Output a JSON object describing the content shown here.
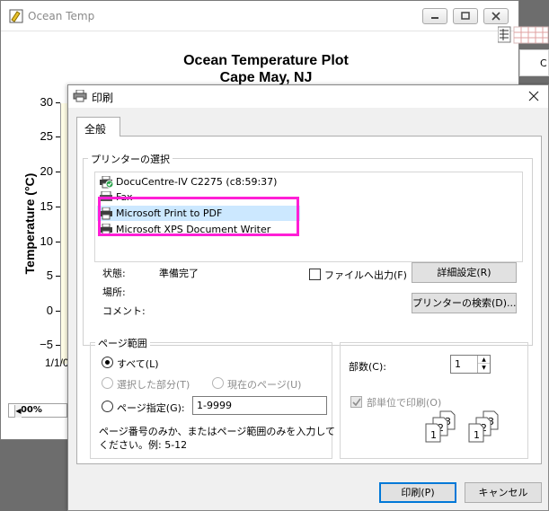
{
  "app": {
    "title": "Ocean Temp",
    "plot_title_line1": "Ocean Temperature Plot",
    "plot_title_line2": "Cape May, NJ",
    "ylabel": "Temperature (°C)",
    "yticks": [
      "30",
      "25",
      "20",
      "15",
      "10",
      "5",
      "0",
      "−5"
    ],
    "xtick_partial": "1/1/0",
    "zoom": "100%",
    "right_strip_char": "C"
  },
  "dialog": {
    "title": "印刷",
    "tab_general": "全般",
    "printer_group_label": "プリンターの選択",
    "printers": [
      {
        "name": "DocuCentre-IV C2275 (c8:59:37)",
        "icon": "default-printer-icon"
      },
      {
        "name": "Fax",
        "icon": "fax-icon"
      },
      {
        "name": "Microsoft Print to PDF",
        "icon": "printer-icon",
        "selected": true
      },
      {
        "name": "Microsoft XPS Document Writer",
        "icon": "printer-icon"
      }
    ],
    "status_label": "状態:",
    "status_value": "準備完了",
    "location_label": "場所:",
    "comment_label": "コメント:",
    "print_to_file_label": "ファイルへ出力(F)",
    "preferences_button": "詳細設定(R)",
    "find_printer_button": "プリンターの検索(D)...",
    "page_range_label": "ページ範囲",
    "range_all": "すべて(L)",
    "range_selection": "選択した部分(T)",
    "range_current": "現在のページ(U)",
    "range_pages": "ページ指定(G):",
    "range_pages_value": "1-9999",
    "range_hint_line1": "ページ番号のみか、またはページ範囲のみを入力して",
    "range_hint_line2": "ください。例: 5-12",
    "copies_label": "部数(C):",
    "copies_value": "1",
    "collate_label": "部単位で印刷(O)",
    "print_button": "印刷(P)",
    "cancel_button": "キャンセル"
  }
}
